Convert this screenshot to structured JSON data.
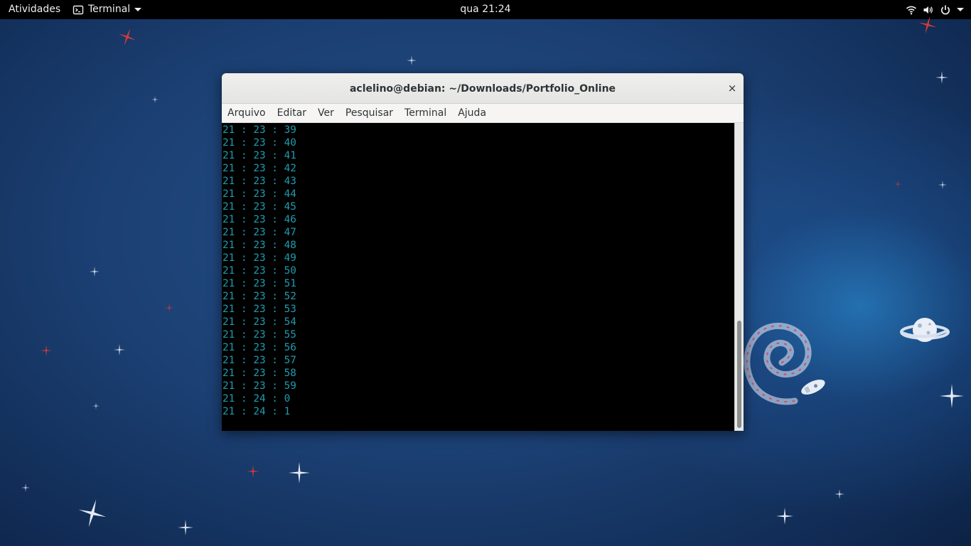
{
  "topbar": {
    "activities_label": "Atividades",
    "app_menu_label": "Terminal",
    "clock": "qua 21:24",
    "status_icons": [
      "wifi-icon",
      "volume-icon",
      "power-icon",
      "chevron-down-icon"
    ]
  },
  "window": {
    "title": "aclelino@debian: ~/Downloads/Portfolio_Online",
    "close_symbol": "×",
    "menu": [
      "Arquivo",
      "Editar",
      "Ver",
      "Pesquisar",
      "Terminal",
      "Ajuda"
    ]
  },
  "terminal": {
    "text_color": "#1e9cae",
    "lines": [
      "21 : 23 : 39",
      "21 : 23 : 40",
      "21 : 23 : 41",
      "21 : 23 : 42",
      "21 : 23 : 43",
      "21 : 23 : 44",
      "21 : 23 : 45",
      "21 : 23 : 46",
      "21 : 23 : 47",
      "21 : 23 : 48",
      "21 : 23 : 49",
      "21 : 23 : 50",
      "21 : 23 : 51",
      "21 : 23 : 52",
      "21 : 23 : 53",
      "21 : 23 : 54",
      "21 : 23 : 55",
      "21 : 23 : 56",
      "21 : 23 : 57",
      "21 : 23 : 58",
      "21 : 23 : 59",
      "21 : 24 : 0",
      "21 : 24 : 1"
    ],
    "scroll_position_fraction": 0.65
  },
  "colors": {
    "desktop_accent": "#1b3f72",
    "topbar": "#000000",
    "terminal_bg": "#000000"
  }
}
